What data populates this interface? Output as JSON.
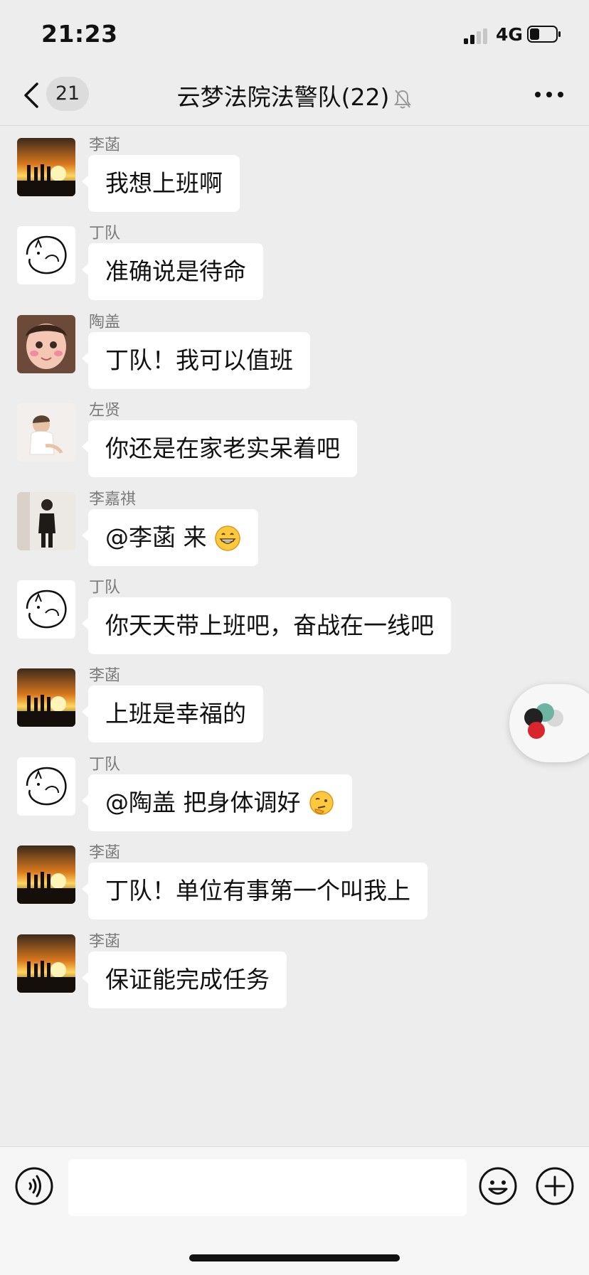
{
  "status": {
    "time": "21:23",
    "network": "4G",
    "battery_level": 0.35
  },
  "header": {
    "unread_count": "21",
    "title": "云梦法院法警队(22)",
    "muted": true
  },
  "messages": [
    {
      "sender": "李菡",
      "text": "我想上班啊",
      "avatar": "sunset"
    },
    {
      "sender": "丁队",
      "text": "准确说是待命",
      "avatar": "cat-sketch"
    },
    {
      "sender": "陶盖",
      "text": "丁队！我可以值班",
      "avatar": "child"
    },
    {
      "sender": "左贤",
      "text": "你还是在家老实呆着吧",
      "avatar": "baby"
    },
    {
      "sender": "李嘉祺",
      "text": "@李菡 来",
      "avatar": "mirror-selfie",
      "emoji": "grin-emoji"
    },
    {
      "sender": "丁队",
      "text": "你天天带上班吧，奋战在一线吧",
      "avatar": "cat-sketch"
    },
    {
      "sender": "李菡",
      "text": "上班是幸福的",
      "avatar": "sunset"
    },
    {
      "sender": "丁队",
      "text": "@陶盖 把身体调好",
      "avatar": "cat-sketch",
      "emoji": "thinking-emoji"
    },
    {
      "sender": "李菡",
      "text": "丁队！单位有事第一个叫我上",
      "avatar": "sunset"
    },
    {
      "sender": "李菡",
      "text": "保证能完成任务",
      "avatar": "sunset"
    }
  ],
  "input": {
    "placeholder": ""
  },
  "colors": {
    "background": "#ededed",
    "bubble": "#ffffff",
    "sender": "#7a7a7a",
    "text": "#111111"
  }
}
